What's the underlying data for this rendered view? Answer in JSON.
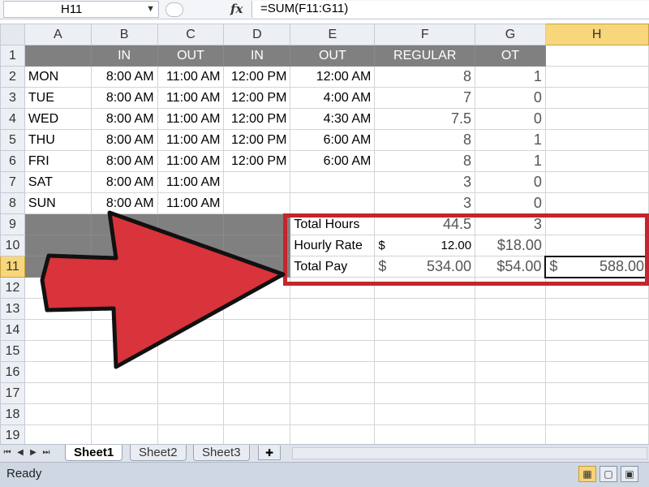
{
  "formula_bar": {
    "name_box": "H11",
    "fx_label": "fx",
    "formula": "=SUM(F11:G11)"
  },
  "columns": [
    "A",
    "B",
    "C",
    "D",
    "E",
    "F",
    "G",
    "H"
  ],
  "rows": [
    "1",
    "2",
    "3",
    "4",
    "5",
    "6",
    "7",
    "8",
    "9",
    "10",
    "11",
    "12",
    "13",
    "14",
    "15",
    "16",
    "17",
    "18",
    "19"
  ],
  "header_row": [
    "",
    "IN",
    "OUT",
    "IN",
    "OUT",
    "REGULAR",
    "OT",
    ""
  ],
  "days": [
    {
      "day": "MON",
      "in1": "8:00 AM",
      "out1": "11:00 AM",
      "in2": "12:00 PM",
      "out2": "12:00 AM",
      "regular": "8",
      "ot": "1"
    },
    {
      "day": "TUE",
      "in1": "8:00 AM",
      "out1": "11:00 AM",
      "in2": "12:00 PM",
      "out2": "4:00 AM",
      "regular": "7",
      "ot": "0"
    },
    {
      "day": "WED",
      "in1": "8:00 AM",
      "out1": "11:00 AM",
      "in2": "12:00 PM",
      "out2": "4:30 AM",
      "regular": "7.5",
      "ot": "0"
    },
    {
      "day": "THU",
      "in1": "8:00 AM",
      "out1": "11:00 AM",
      "in2": "12:00 PM",
      "out2": "6:00 AM",
      "regular": "8",
      "ot": "1"
    },
    {
      "day": "FRI",
      "in1": "8:00 AM",
      "out1": "11:00 AM",
      "in2": "12:00 PM",
      "out2": "6:00 AM",
      "regular": "8",
      "ot": "1"
    },
    {
      "day": "SAT",
      "in1": "8:00 AM",
      "out1": "11:00 AM",
      "in2": "",
      "out2": "",
      "regular": "3",
      "ot": "0"
    },
    {
      "day": "SUN",
      "in1": "8:00 AM",
      "out1": "11:00 AM",
      "in2": "",
      "out2": "",
      "regular": "3",
      "ot": "0"
    }
  ],
  "summary": {
    "total_hours_label": "Total Hours",
    "total_hours_regular": "44.5",
    "total_hours_ot": "3",
    "hourly_rate_label": "Hourly Rate",
    "hourly_rate_currency": "$",
    "hourly_rate_regular": "12.00",
    "hourly_rate_ot": "$18.00",
    "total_pay_label": "Total Pay",
    "total_pay_currency": "$",
    "total_pay_regular": "534.00",
    "total_pay_ot": "$54.00",
    "grand_total_currency": "$",
    "grand_total": "588.00"
  },
  "sheet_tabs": [
    "Sheet1",
    "Sheet2",
    "Sheet3"
  ],
  "active_sheet": "Sheet1",
  "status": "Ready",
  "colors": {
    "header_fill": "#808080",
    "highlight": "#c4252e",
    "arrow_fill": "#d9333b",
    "selection": "#f8d67b"
  }
}
